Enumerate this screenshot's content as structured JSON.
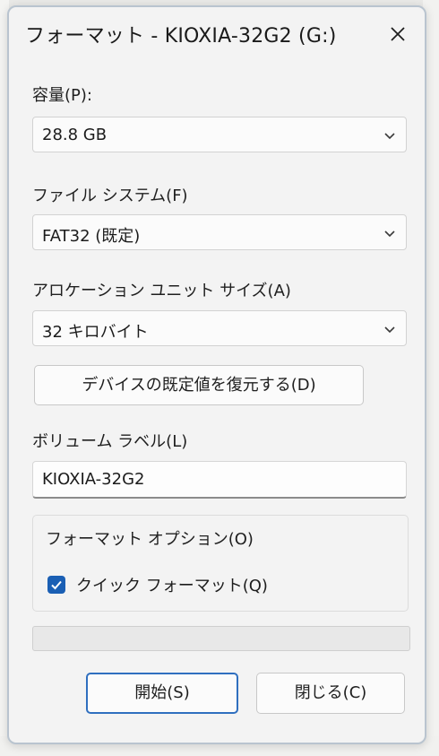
{
  "window": {
    "title": "フォーマット - KIOXIA-32G2 (G:)"
  },
  "capacity": {
    "label": "容量(P):",
    "selected": "28.8 GB"
  },
  "file_system": {
    "label": "ファイル システム(F)",
    "selected": "FAT32 (既定)"
  },
  "allocation_unit": {
    "label": "アロケーション ユニット サイズ(A)",
    "selected": "32 キロバイト"
  },
  "restore_defaults_button": "デバイスの既定値を復元する(D)",
  "volume_label": {
    "label": "ボリューム ラベル(L)",
    "value": "KIOXIA-32G2"
  },
  "format_options": {
    "title": "フォーマット オプション(O)",
    "quick_format": {
      "label": "クイック フォーマット(Q)",
      "checked": true
    }
  },
  "progress": {
    "percent": 0
  },
  "buttons": {
    "start": "開始(S)",
    "close": "閉じる(C)"
  },
  "icons": {
    "close": "close-icon",
    "chevron": "chevron-down-icon",
    "check": "checkmark-icon"
  },
  "colors": {
    "accent": "#1a5fb4",
    "default_button_border": "#2f6fbf"
  }
}
